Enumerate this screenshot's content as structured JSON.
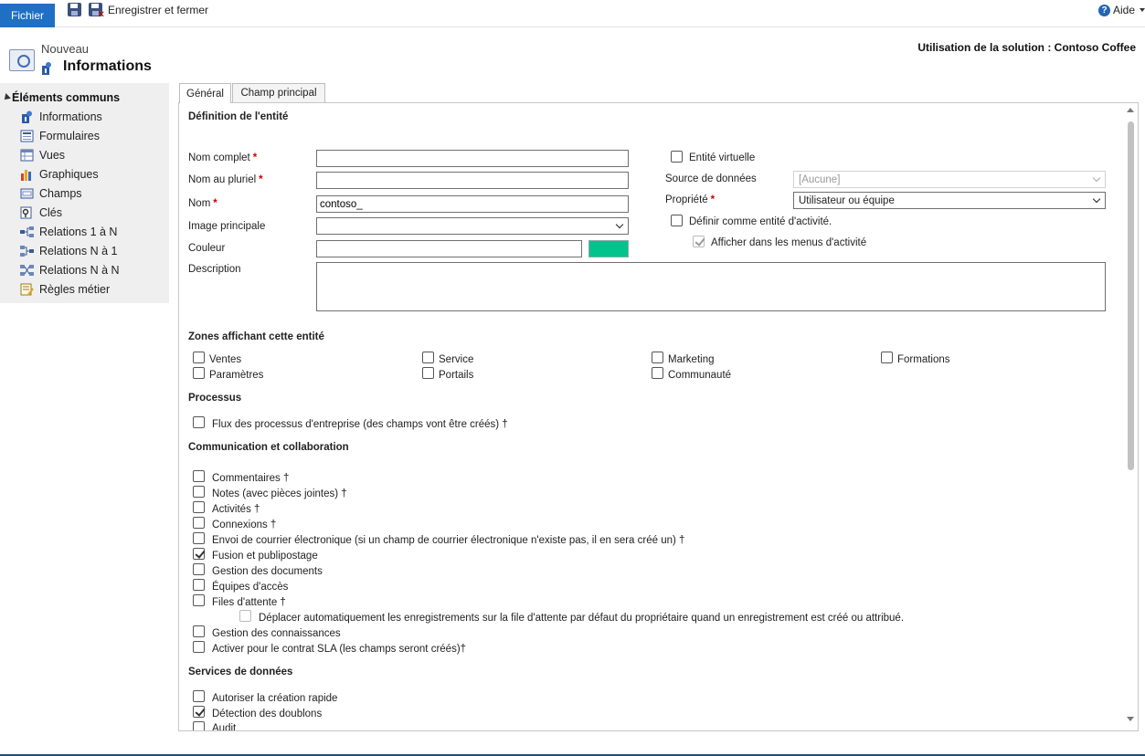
{
  "ribbon": {
    "file_label": "Fichier",
    "save_close_label": "Enregistrer et fermer",
    "help_label": "Aide"
  },
  "header": {
    "subtitle": "Nouveau",
    "title": "Informations",
    "solution": "Utilisation de la solution : Contoso Coffee"
  },
  "sidebar": {
    "header": "Éléments communs",
    "items": [
      {
        "label": "Informations",
        "icon": "info-icon"
      },
      {
        "label": "Formulaires",
        "icon": "form-icon"
      },
      {
        "label": "Vues",
        "icon": "view-icon"
      },
      {
        "label": "Graphiques",
        "icon": "chart-icon"
      },
      {
        "label": "Champs",
        "icon": "field-icon"
      },
      {
        "label": "Clés",
        "icon": "key-icon"
      },
      {
        "label": "Relations 1 à N",
        "icon": "relation-icon"
      },
      {
        "label": "Relations N à 1",
        "icon": "relation-icon"
      },
      {
        "label": "Relations N à N",
        "icon": "relation-icon"
      },
      {
        "label": "Règles métier",
        "icon": "rules-icon"
      }
    ]
  },
  "tabs": {
    "general": "Général",
    "primary_field": "Champ principal"
  },
  "definition": {
    "title": "Définition de l'entité",
    "display_name_label": "Nom complet",
    "display_name_value": "",
    "plural_name_label": "Nom au pluriel",
    "plural_name_value": "",
    "name_label": "Nom",
    "name_value": "contoso_",
    "primary_image_label": "Image principale",
    "primary_image_value": "",
    "color_label": "Couleur",
    "color_value": "",
    "color_swatch": "#00c48c",
    "description_label": "Description",
    "description_value": "",
    "virtual_entity_label": "Entité virtuelle",
    "data_source_label": "Source de données",
    "data_source_value": "[Aucune]",
    "ownership_label": "Propriété",
    "ownership_value": "Utilisateur ou équipe",
    "activity_entity_label": "Définir comme entité d'activité.",
    "activity_menus_label": "Afficher dans les menus d'activité"
  },
  "areas": {
    "title": "Zones affichant cette entité",
    "items": [
      "Ventes",
      "Service",
      "Marketing",
      "Formations",
      "Paramètres",
      "Portails",
      "Communauté"
    ]
  },
  "process": {
    "title": "Processus",
    "bpf_label": "Flux des processus d'entreprise (des champs vont être créés) †"
  },
  "communication": {
    "title": "Communication et collaboration",
    "items": [
      "Commentaires †",
      "Notes (avec pièces jointes) †",
      "Activités †",
      "Connexions †",
      "Envoi de courrier électronique (si un champ de courrier électronique n'existe pas, il en sera créé un) †",
      "Fusion et publipostage",
      "Gestion des documents",
      "Équipes d'accès",
      "Files d'attente †"
    ],
    "queue_sub": "Déplacer automatiquement les enregistrements sur la file d'attente par défaut du propriétaire quand un enregistrement est créé ou attribué.",
    "after_items": [
      "Gestion des connaissances",
      "Activer pour le contrat SLA (les champs seront créés)†"
    ]
  },
  "data_services": {
    "title": "Services de données",
    "items": [
      "Autoriser la création rapide",
      "Détection des doublons",
      "Audit"
    ]
  }
}
